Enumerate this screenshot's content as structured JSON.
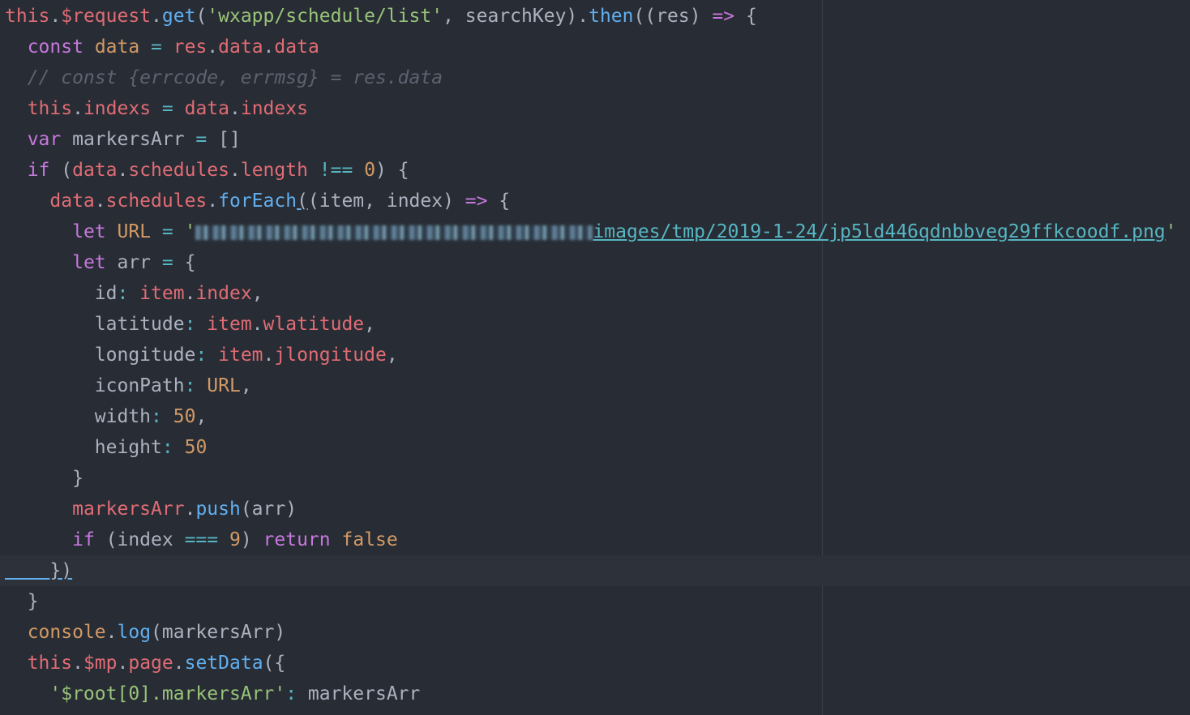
{
  "editor": {
    "active_line": 18,
    "lines": [
      {
        "tokens": [
          {
            "t": "this",
            "c": "c-red"
          },
          {
            "t": ".",
            "c": "c-plain"
          },
          {
            "t": "$request",
            "c": "c-red"
          },
          {
            "t": ".",
            "c": "c-plain"
          },
          {
            "t": "get",
            "c": "c-blue"
          },
          {
            "t": "(",
            "c": "c-plain"
          },
          {
            "t": "'wxapp/schedule/list'",
            "c": "c-green"
          },
          {
            "t": ", searchKey).",
            "c": "c-plain"
          },
          {
            "t": "then",
            "c": "c-blue"
          },
          {
            "t": "((res) ",
            "c": "c-plain"
          },
          {
            "t": "=>",
            "c": "c-purple"
          },
          {
            "t": " {",
            "c": "c-plain"
          }
        ]
      },
      {
        "tokens": [
          {
            "t": "  ",
            "c": "c-plain"
          },
          {
            "t": "const",
            "c": "c-purple"
          },
          {
            "t": " ",
            "c": "c-plain"
          },
          {
            "t": "data",
            "c": "c-orange"
          },
          {
            "t": " = ",
            "c": "c-cyan"
          },
          {
            "t": "res",
            "c": "c-red"
          },
          {
            "t": ".",
            "c": "c-plain"
          },
          {
            "t": "data",
            "c": "c-red"
          },
          {
            "t": ".",
            "c": "c-plain"
          },
          {
            "t": "data",
            "c": "c-red"
          }
        ]
      },
      {
        "tokens": [
          {
            "t": "  // const {errcode, errmsg} = res.data",
            "c": "c-comment"
          }
        ]
      },
      {
        "tokens": [
          {
            "t": "  ",
            "c": "c-plain"
          },
          {
            "t": "this",
            "c": "c-red"
          },
          {
            "t": ".",
            "c": "c-plain"
          },
          {
            "t": "indexs",
            "c": "c-red"
          },
          {
            "t": " = ",
            "c": "c-cyan"
          },
          {
            "t": "data",
            "c": "c-red"
          },
          {
            "t": ".",
            "c": "c-plain"
          },
          {
            "t": "indexs",
            "c": "c-red"
          }
        ]
      },
      {
        "tokens": [
          {
            "t": "  ",
            "c": "c-plain"
          },
          {
            "t": "var",
            "c": "c-purple"
          },
          {
            "t": " markersArr ",
            "c": "c-plain"
          },
          {
            "t": "=",
            "c": "c-cyan"
          },
          {
            "t": " []",
            "c": "c-plain"
          }
        ]
      },
      {
        "tokens": [
          {
            "t": "  ",
            "c": "c-plain"
          },
          {
            "t": "if",
            "c": "c-purple"
          },
          {
            "t": " (",
            "c": "c-plain"
          },
          {
            "t": "data",
            "c": "c-red"
          },
          {
            "t": ".",
            "c": "c-plain"
          },
          {
            "t": "schedules",
            "c": "c-red"
          },
          {
            "t": ".",
            "c": "c-plain"
          },
          {
            "t": "length",
            "c": "c-red"
          },
          {
            "t": " !== ",
            "c": "c-cyan"
          },
          {
            "t": "0",
            "c": "c-orange"
          },
          {
            "t": ") {",
            "c": "c-plain"
          }
        ]
      },
      {
        "tokens": [
          {
            "t": "    ",
            "c": "c-plain"
          },
          {
            "t": "data",
            "c": "c-red"
          },
          {
            "t": ".",
            "c": "c-plain"
          },
          {
            "t": "schedules",
            "c": "c-red"
          },
          {
            "t": ".",
            "c": "c-plain"
          },
          {
            "t": "forEach",
            "c": "c-blue"
          },
          {
            "t": "(",
            "c": "c-plain bracket-match"
          },
          {
            "t": "(item, index) ",
            "c": "c-plain"
          },
          {
            "t": "=>",
            "c": "c-purple"
          },
          {
            "t": " {",
            "c": "c-plain"
          }
        ]
      },
      {
        "tokens": [
          {
            "t": "      ",
            "c": "c-plain"
          },
          {
            "t": "let",
            "c": "c-purple"
          },
          {
            "t": " ",
            "c": "c-plain"
          },
          {
            "t": "URL",
            "c": "c-orange"
          },
          {
            "t": " = ",
            "c": "c-cyan"
          },
          {
            "t": "'",
            "c": "c-green"
          },
          {
            "t": "",
            "c": "blur"
          },
          {
            "t": "images/tmp/2019-1-24/jp5ld446qdnbbveg29ffkcoodf.png",
            "c": "c-url"
          },
          {
            "t": "'",
            "c": "c-green"
          }
        ]
      },
      {
        "tokens": [
          {
            "t": "      ",
            "c": "c-plain"
          },
          {
            "t": "let",
            "c": "c-purple"
          },
          {
            "t": " arr ",
            "c": "c-plain"
          },
          {
            "t": "=",
            "c": "c-cyan"
          },
          {
            "t": " {",
            "c": "c-plain"
          }
        ]
      },
      {
        "tokens": [
          {
            "t": "        id",
            "c": "c-plain"
          },
          {
            "t": ":",
            "c": "c-cyan"
          },
          {
            "t": " ",
            "c": "c-plain"
          },
          {
            "t": "item",
            "c": "c-red"
          },
          {
            "t": ".",
            "c": "c-plain"
          },
          {
            "t": "index",
            "c": "c-red"
          },
          {
            "t": ",",
            "c": "c-plain"
          }
        ]
      },
      {
        "tokens": [
          {
            "t": "        latitude",
            "c": "c-plain"
          },
          {
            "t": ":",
            "c": "c-cyan"
          },
          {
            "t": " ",
            "c": "c-plain"
          },
          {
            "t": "item",
            "c": "c-red"
          },
          {
            "t": ".",
            "c": "c-plain"
          },
          {
            "t": "wlatitude",
            "c": "c-red"
          },
          {
            "t": ",",
            "c": "c-plain"
          }
        ]
      },
      {
        "tokens": [
          {
            "t": "        longitude",
            "c": "c-plain"
          },
          {
            "t": ":",
            "c": "c-cyan"
          },
          {
            "t": " ",
            "c": "c-plain"
          },
          {
            "t": "item",
            "c": "c-red"
          },
          {
            "t": ".",
            "c": "c-plain"
          },
          {
            "t": "jlongitude",
            "c": "c-red"
          },
          {
            "t": ",",
            "c": "c-plain"
          }
        ]
      },
      {
        "tokens": [
          {
            "t": "        iconPath",
            "c": "c-plain"
          },
          {
            "t": ":",
            "c": "c-cyan"
          },
          {
            "t": " ",
            "c": "c-plain"
          },
          {
            "t": "URL",
            "c": "c-orange"
          },
          {
            "t": ",",
            "c": "c-plain"
          }
        ]
      },
      {
        "tokens": [
          {
            "t": "        width",
            "c": "c-plain"
          },
          {
            "t": ":",
            "c": "c-cyan"
          },
          {
            "t": " ",
            "c": "c-plain"
          },
          {
            "t": "50",
            "c": "c-orange"
          },
          {
            "t": ",",
            "c": "c-plain"
          }
        ]
      },
      {
        "tokens": [
          {
            "t": "        height",
            "c": "c-plain"
          },
          {
            "t": ":",
            "c": "c-cyan"
          },
          {
            "t": " ",
            "c": "c-plain"
          },
          {
            "t": "50",
            "c": "c-orange"
          }
        ]
      },
      {
        "tokens": [
          {
            "t": "      }",
            "c": "c-plain"
          }
        ]
      },
      {
        "tokens": [
          {
            "t": "      ",
            "c": "c-plain"
          },
          {
            "t": "markersArr",
            "c": "c-red"
          },
          {
            "t": ".",
            "c": "c-plain"
          },
          {
            "t": "push",
            "c": "c-blue"
          },
          {
            "t": "(arr)",
            "c": "c-plain"
          }
        ]
      },
      {
        "tokens": [
          {
            "t": "      ",
            "c": "c-plain"
          },
          {
            "t": "if",
            "c": "c-purple"
          },
          {
            "t": " (index ",
            "c": "c-plain"
          },
          {
            "t": "===",
            "c": "c-cyan"
          },
          {
            "t": " ",
            "c": "c-plain"
          },
          {
            "t": "9",
            "c": "c-orange"
          },
          {
            "t": ") ",
            "c": "c-plain"
          },
          {
            "t": "return",
            "c": "c-purple"
          },
          {
            "t": " ",
            "c": "c-plain"
          },
          {
            "t": "false",
            "c": "c-orange"
          }
        ]
      },
      {
        "tokens": [
          {
            "t": "    })",
            "c": "c-plain bracket-match"
          }
        ]
      },
      {
        "tokens": [
          {
            "t": "  }",
            "c": "c-plain"
          }
        ]
      },
      {
        "tokens": [
          {
            "t": "  ",
            "c": "c-plain"
          },
          {
            "t": "console",
            "c": "c-orange"
          },
          {
            "t": ".",
            "c": "c-plain"
          },
          {
            "t": "log",
            "c": "c-blue"
          },
          {
            "t": "(markersArr)",
            "c": "c-plain"
          }
        ]
      },
      {
        "tokens": [
          {
            "t": "  ",
            "c": "c-plain"
          },
          {
            "t": "this",
            "c": "c-red"
          },
          {
            "t": ".",
            "c": "c-plain"
          },
          {
            "t": "$mp",
            "c": "c-red"
          },
          {
            "t": ".",
            "c": "c-plain"
          },
          {
            "t": "page",
            "c": "c-red"
          },
          {
            "t": ".",
            "c": "c-plain"
          },
          {
            "t": "setData",
            "c": "c-blue"
          },
          {
            "t": "({",
            "c": "c-plain"
          }
        ]
      },
      {
        "tokens": [
          {
            "t": "    ",
            "c": "c-plain"
          },
          {
            "t": "'$root[0].markersArr'",
            "c": "c-green"
          },
          {
            "t": ":",
            "c": "c-cyan"
          },
          {
            "t": " markersArr",
            "c": "c-plain"
          }
        ]
      }
    ]
  },
  "colors": {
    "background": "#282c34",
    "active_line": "#2c313a",
    "ruler": "#3b4048"
  }
}
